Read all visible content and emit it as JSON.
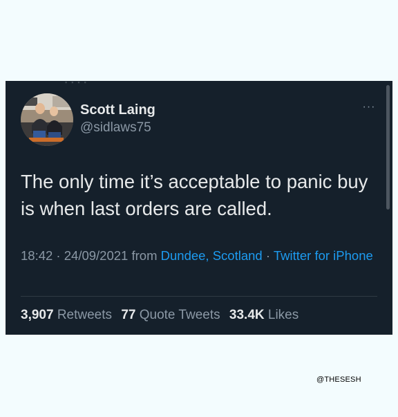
{
  "colors": {
    "page_background": "#f3fcfe",
    "card_background": "#15202b",
    "primary_text": "#e7e9ea",
    "secondary_text": "#8b98a5",
    "link": "#1d9bf0",
    "divider": "#2f3a44"
  },
  "tweet": {
    "author": {
      "display_name": "Scott Laing",
      "handle": "@sidlaws75",
      "avatar": "profile-photo-two-people-seated"
    },
    "more_icon": "ellipsis-icon",
    "more_label": "···",
    "text": "The only time it’s acceptable to panic buy is when last orders are called.",
    "meta": {
      "time": "18:42",
      "separator_1": " · ",
      "date": "24/09/2021",
      "from_label": " from ",
      "location": "Dundee, Scotland",
      "separator_2": " · ",
      "client": "Twitter for iPhone"
    },
    "stats": {
      "retweets_count": "3,907",
      "retweets_label": "Retweets",
      "quote_tweets_count": "77",
      "quote_tweets_label": "Quote Tweets",
      "likes_count": "33.4K",
      "likes_label": "Likes"
    }
  },
  "watermark": {
    "text": "@THESESH"
  }
}
